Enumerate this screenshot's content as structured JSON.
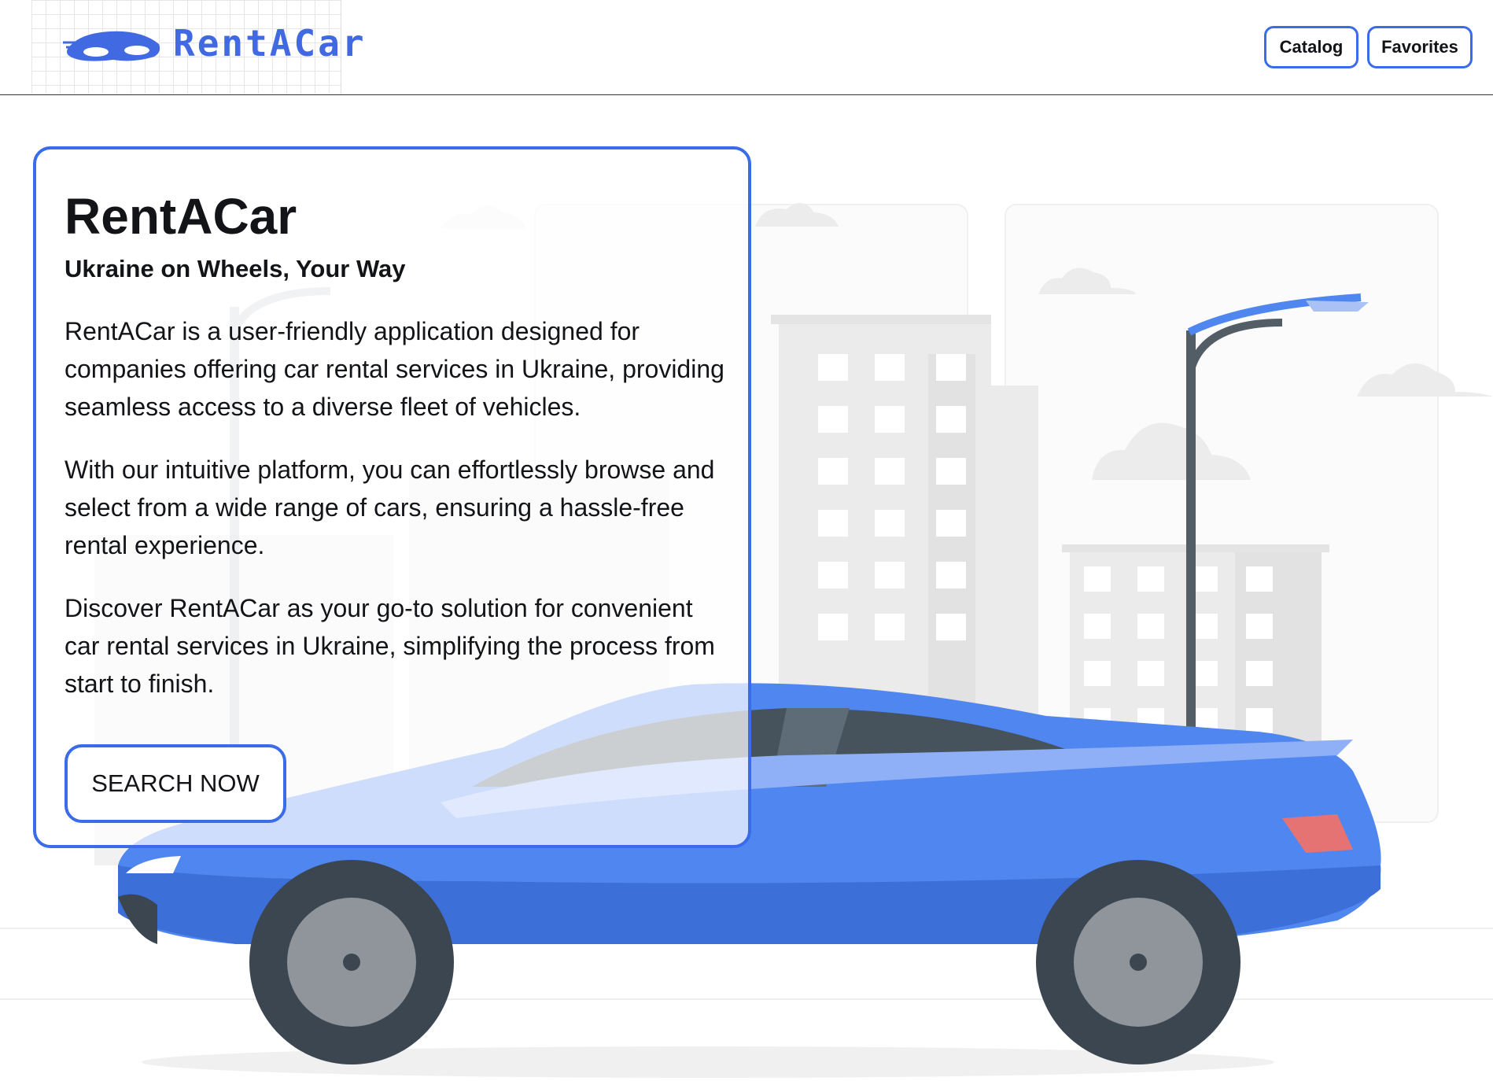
{
  "header": {
    "logo_text": "RentACar",
    "nav": {
      "catalog_label": "Catalog",
      "favorites_label": "Favorites"
    }
  },
  "hero": {
    "title": "RentACar",
    "subtitle": "Ukraine on Wheels, Your Way",
    "paragraphs": [
      "RentACar is a user-friendly application designed for companies offering car rental services in Ukraine, providing seamless access to a diverse fleet of vehicles.",
      "With our intuitive platform, you can effortlessly browse and select from a wide range of cars, ensuring a hassle-free rental experience.",
      "Discover RentACar as your go-to solution for convenient car rental services in Ukraine, simplifying the process from start to finish."
    ],
    "cta_label": "SEARCH NOW"
  },
  "colors": {
    "accent": "#3a6be8",
    "car_body": "#4f86f0",
    "text": "#121417"
  }
}
